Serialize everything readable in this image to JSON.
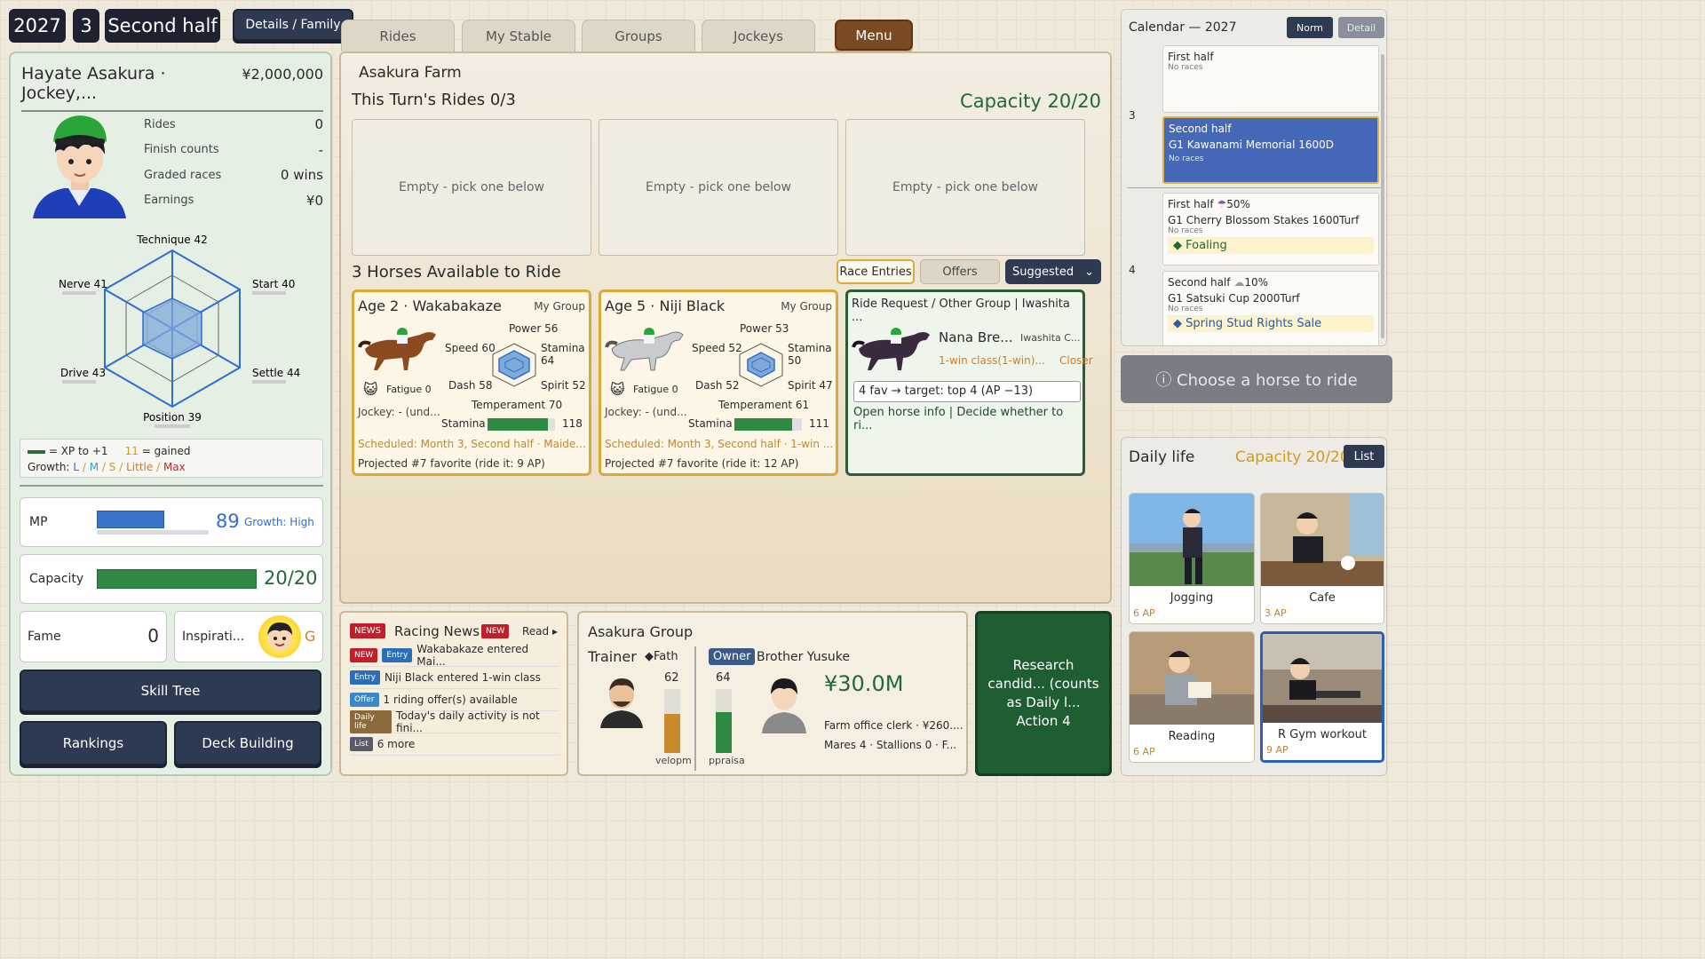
{
  "topbar": {
    "year": "2027",
    "month": "3",
    "half": "Second half",
    "details_label": "Details / Family"
  },
  "jockey": {
    "name": "Hayate Asakura · Jockey,...",
    "money": "¥2,000,000",
    "stats": [
      {
        "k": "Rides",
        "v": "0"
      },
      {
        "k": "Finish counts",
        "v": "-"
      },
      {
        "k": "Graded races",
        "v": "0 wins"
      },
      {
        "k": "Earnings",
        "v": "¥0"
      }
    ],
    "radar": {
      "technique": "Technique 42",
      "start": "Start 40",
      "settle": "Settle 44",
      "position": "Position 39",
      "drive": "Drive 43",
      "nerve": "Nerve 41"
    },
    "legend": {
      "xp": "= XP to +1",
      "gained_num": "11",
      "gained": "= gained",
      "growth": "Growth:",
      "l": "L",
      "m": "M",
      "s": "S",
      "little": "Little",
      "max": "Max",
      "sep": "/"
    },
    "mp": {
      "label": "MP",
      "value": "89",
      "growth": "Growth: High",
      "fraction": 0.6
    },
    "capacity": {
      "label": "Capacity",
      "value": "20/20",
      "fraction": 1.0
    },
    "fame": {
      "label": "Fame",
      "value": "0"
    },
    "inspiration": {
      "label": "Inspirati...",
      "grade": "G"
    },
    "buttons": {
      "skill_tree": "Skill Tree",
      "rankings": "Rankings",
      "deck": "Deck Building"
    }
  },
  "tabs": {
    "rides": "Rides",
    "stable": "My Stable",
    "groups": "Groups",
    "jockeys": "Jockeys",
    "menu": "Menu"
  },
  "main": {
    "farm": "Asakura Farm",
    "turn_rides": "This Turn's Rides 0/3",
    "capacity": "Capacity 20/20",
    "slots": [
      "Empty - pick one below",
      "Empty - pick one below",
      "Empty - pick one below"
    ],
    "available": "3 Horses Available to Ride",
    "filters": {
      "entries": "Race Entries",
      "offers": "Offers",
      "sort": "Suggested"
    },
    "horses": [
      {
        "title": "Age 2 · Wakabakaze",
        "group": "My Group",
        "power": "Power 56",
        "speed": "Speed 60",
        "stamina_r": "Stamina 64",
        "dash": "Dash 58",
        "spirit": "Spirit 52",
        "fatigue": "Fatigue 0",
        "temperament": "Temperament 70",
        "jockey": "Jockey: - (und...",
        "stamina_label": "Stamina",
        "stamina_val": "118",
        "stamina_fraction": 0.9,
        "scheduled": "Scheduled: Month 3, Second half · Maide...",
        "projected": "Projected #7 favorite (ride it: 9 AP)"
      },
      {
        "title": "Age 5 · Niji Black",
        "group": "My Group",
        "power": "Power 53",
        "speed": "Speed 52",
        "stamina_r": "Stamina 50",
        "dash": "Dash 52",
        "spirit": "Spirit 47",
        "fatigue": "Fatigue 0",
        "temperament": "Temperament 61",
        "jockey": "Jockey: - (und...",
        "stamina_label": "Stamina",
        "stamina_val": "111",
        "stamina_fraction": 0.85,
        "scheduled": "Scheduled: Month 3, Second half · 1-win ...",
        "projected": "Projected #7 favorite (ride it: 12 AP)"
      }
    ],
    "request": {
      "title": "Ride Request / Other Group | Iwashita ...",
      "horse": "Nana Bre...",
      "owner": "Iwashita C...",
      "class": "1-win class(1-win)...",
      "style": "Closer",
      "target": "4 fav → target: top 4 (AP −13)",
      "actions": "Open horse info | Decide whether to ri..."
    }
  },
  "news": {
    "badge": "NEWS",
    "title": "Racing News",
    "new": "NEW",
    "read": "Read ▸",
    "rows": [
      {
        "tag1": "NEW",
        "tag2": "Entry",
        "text": "Wakabakaze entered Mai..."
      },
      {
        "tag2": "Entry",
        "text": "Niji Black entered 1-win class"
      },
      {
        "tag2": "Offer",
        "text": "1 riding offer(s) available"
      },
      {
        "tag2": "Daily life",
        "text": "Today's daily activity is not fini..."
      },
      {
        "tag2": "List",
        "text": "6 more"
      }
    ]
  },
  "group": {
    "title": "Asakura Group",
    "trainer": "Trainer",
    "trainer_name": "◆Fath",
    "owner_tag": "Owner",
    "owner_name": "Brother Yusuke",
    "val1": "62",
    "val2": "64",
    "lbl1": "velopm",
    "lbl2": "ppraisa",
    "funds": "¥30.0M",
    "clerk": "Farm office clerk · ¥260....",
    "mares": "Mares 4 · Stallions 0 · F..."
  },
  "research": "Research candid... (counts as Daily l... Action 4",
  "calendar": {
    "title": "Calendar — 2027",
    "norm": "Norm",
    "detail": "Detail",
    "month3": "3",
    "month4": "4",
    "c1": {
      "half": "First half",
      "note": "No races"
    },
    "c2": {
      "half": "Second half",
      "race": "G1 Kawanami Memorial 1600D",
      "note": "No races"
    },
    "c3": {
      "half": "First half",
      "rain": "50%",
      "race": "G1 Cherry Blossom Stakes 1600Turf",
      "note": "No races",
      "event": "◆ Foaling"
    },
    "c4": {
      "half": "Second half",
      "rain": "10%",
      "race": "G1 Satsuki Cup 2000Turf",
      "note": "No races",
      "event": "◆ Spring Stud Rights Sale"
    }
  },
  "choose": "ⓘ Choose a horse to ride",
  "daily": {
    "title": "Daily life",
    "capacity": "Capacity 20/20",
    "list": "List",
    "acts": [
      {
        "label": "Jogging",
        "ap": "6 AP"
      },
      {
        "label": "Cafe",
        "ap": "3 AP"
      },
      {
        "label": "Reading",
        "ap": "6 AP"
      },
      {
        "label": "R  Gym workout",
        "ap": "9 AP"
      }
    ]
  },
  "colors": {
    "accent_green": "#1f6b35",
    "navy": "#2e3a52",
    "menu_brown": "#7a4a22",
    "gold": "#d9a93a",
    "cal_selected": "#4569b8"
  }
}
